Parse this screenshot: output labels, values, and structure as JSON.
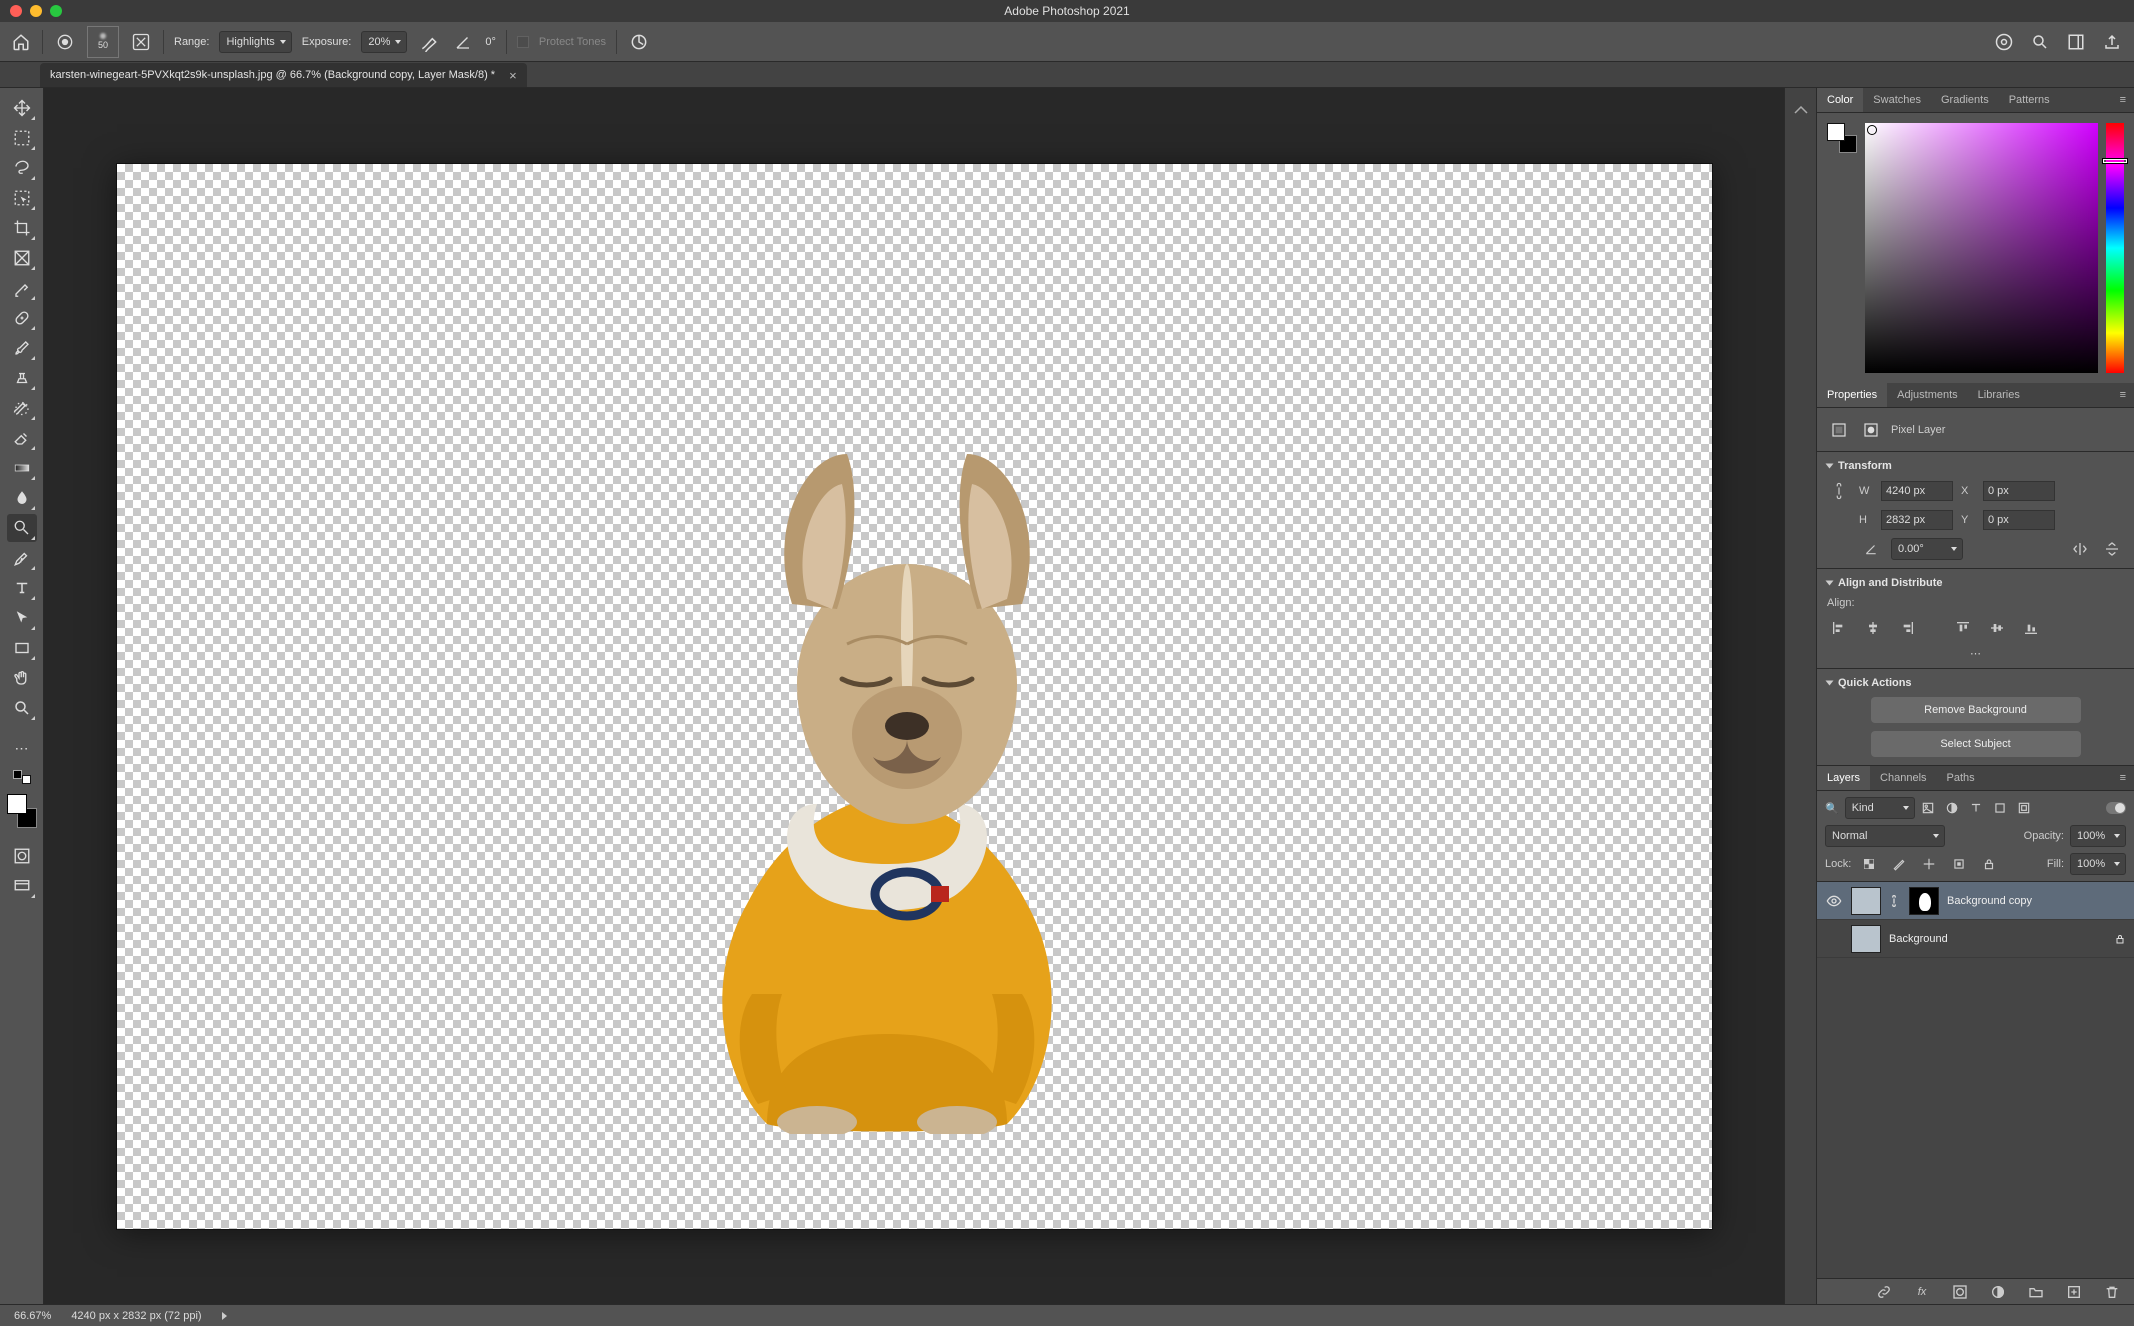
{
  "app": {
    "title": "Adobe Photoshop 2021"
  },
  "options": {
    "brush_size": "50",
    "range_label": "Range:",
    "range_value": "Highlights",
    "exposure_label": "Exposure:",
    "exposure_value": "20%",
    "angle_value": "0°",
    "protect_tones": "Protect Tones"
  },
  "document": {
    "tab_title": "karsten-winegeart-5PVXkqt2s9k-unsplash.jpg @ 66.7% (Background copy, Layer Mask/8) *"
  },
  "panel_tabs": {
    "color": [
      "Color",
      "Swatches",
      "Gradients",
      "Patterns"
    ],
    "props": [
      "Properties",
      "Adjustments",
      "Libraries"
    ],
    "layers": [
      "Layers",
      "Channels",
      "Paths"
    ]
  },
  "properties": {
    "layer_kind": "Pixel Layer",
    "transform_header": "Transform",
    "W": "4240 px",
    "H": "2832 px",
    "X": "0 px",
    "Y": "0 px",
    "angle": "0.00°",
    "align_header": "Align and Distribute",
    "align_label": "Align:",
    "qa_header": "Quick Actions",
    "qa_remove_bg": "Remove Background",
    "qa_select_subject": "Select Subject"
  },
  "layers": {
    "filter_kind": "Kind",
    "blend_mode": "Normal",
    "opacity_label": "Opacity:",
    "opacity_value": "100%",
    "fill_label": "Fill:",
    "fill_value": "100%",
    "lock_label": "Lock:",
    "items": [
      {
        "name": "Background copy",
        "visible": true,
        "selected": true,
        "has_mask": true
      },
      {
        "name": "Background",
        "visible": false,
        "selected": false,
        "locked": true
      }
    ]
  },
  "status": {
    "zoom": "66.67%",
    "dims": "4240 px x 2832 px (72 ppi)"
  }
}
